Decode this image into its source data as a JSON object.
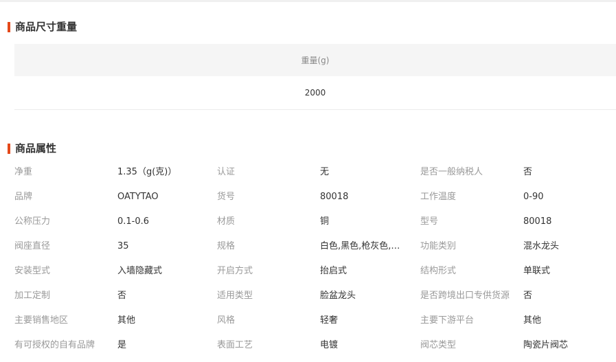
{
  "size_section": {
    "title": "商品尺寸重量",
    "column_header": "重量(g)",
    "value": "2000"
  },
  "attr_section": {
    "title": "商品属性",
    "rows": [
      [
        {
          "label": "净重",
          "value": "1.35（g(克)）"
        },
        {
          "label": "认证",
          "value": "无"
        },
        {
          "label": "是否一般纳税人",
          "value": "否"
        }
      ],
      [
        {
          "label": "品牌",
          "value": "OATYTAO"
        },
        {
          "label": "货号",
          "value": "80018"
        },
        {
          "label": "工作温度",
          "value": "0-90"
        }
      ],
      [
        {
          "label": "公称压力",
          "value": "0.1-0.6"
        },
        {
          "label": "材质",
          "value": "铜"
        },
        {
          "label": "型号",
          "value": "80018"
        }
      ],
      [
        {
          "label": "阀座直径",
          "value": "35"
        },
        {
          "label": "规格",
          "value": "白色,黑色,枪灰色,拉丝金,拉丝"
        },
        {
          "label": "功能类别",
          "value": "混水龙头"
        }
      ],
      [
        {
          "label": "安装型式",
          "value": "入墙隐藏式"
        },
        {
          "label": "开启方式",
          "value": "抬启式"
        },
        {
          "label": "结构形式",
          "value": "单联式"
        }
      ],
      [
        {
          "label": "加工定制",
          "value": "否"
        },
        {
          "label": "适用类型",
          "value": "脸盆龙头"
        },
        {
          "label": "是否跨境出口专供货源",
          "value": "否"
        }
      ],
      [
        {
          "label": "主要销售地区",
          "value": "其他"
        },
        {
          "label": "风格",
          "value": "轻奢"
        },
        {
          "label": "主要下游平台",
          "value": "其他"
        }
      ],
      [
        {
          "label": "有可授权的自有品牌",
          "value": "是"
        },
        {
          "label": "表面工艺",
          "value": "电镀"
        },
        {
          "label": "阀芯类型",
          "value": "陶瓷片阀芯"
        }
      ]
    ]
  },
  "colors": {
    "accent": "#e4491a",
    "label": "#999999",
    "value": "#333333",
    "table_header_bg": "#f5f5f5"
  }
}
